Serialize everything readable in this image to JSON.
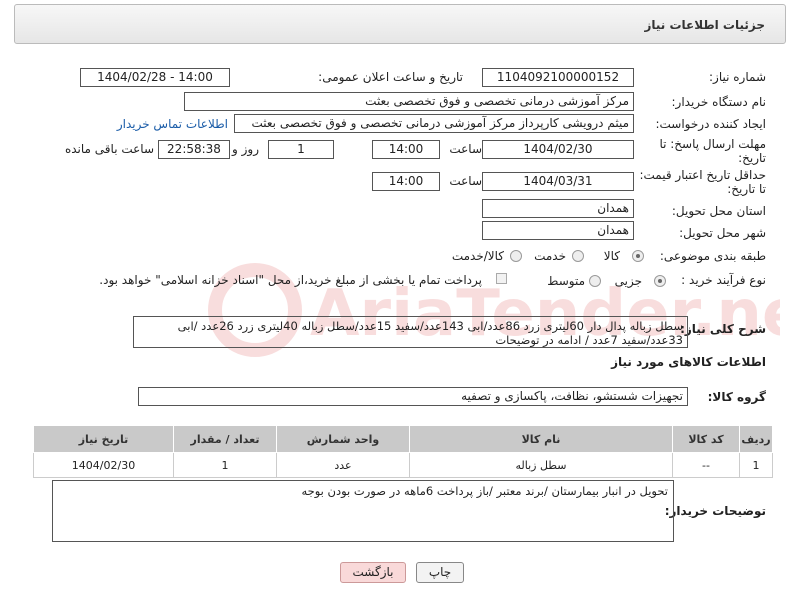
{
  "header": {
    "title": "جزئیات اطلاعات نیاز"
  },
  "form": {
    "need_number_label": "شماره نیاز:",
    "need_number": "1104092100000152",
    "announce_label": "تاریخ و ساعت اعلان عمومی:",
    "announce_value": "1404/02/28 - 14:00",
    "buyer_org_label": "نام دستگاه خریدار:",
    "buyer_org": "مرکز آموزشی درمانی تخصصی و فوق تخصصی بعثت",
    "creator_label": "ایجاد کننده درخواست:",
    "creator": "میثم درویشی کارپرداز مرکز آموزشی درمانی تخصصی و فوق تخصصی بعثت",
    "contact_link": "اطلاعات تماس خریدار",
    "reply_deadline_label_1": "مهلت ارسال پاسخ: تا",
    "reply_deadline_label_2": "تاریخ:",
    "reply_date": "1404/02/30",
    "time_label": "ساعت",
    "reply_time": "14:00",
    "days_value": "1",
    "days_label": "روز و",
    "remaining_time": "22:58:38",
    "remaining_label": "ساعت باقی مانده",
    "price_validity_label_1": "حداقل تاریخ اعتبار قیمت:",
    "price_validity_label_2": "تا تاریخ:",
    "price_date": "1404/03/31",
    "price_time": "14:00",
    "province_label": "استان محل تحویل:",
    "province": "همدان",
    "city_label": "شهر محل تحویل:",
    "city": "همدان",
    "category_label": "طبقه بندی موضوعی:",
    "category_options": [
      "کالا",
      "خدمت",
      "کالا/خدمت"
    ],
    "category_selected": "کالا",
    "process_label": "نوع فرآیند خرید :",
    "process_options": [
      "جزیی",
      "متوسط"
    ],
    "process_selected": "جزیی",
    "payment_note": "پرداخت تمام یا بخشی از مبلغ خرید،از محل \"اسناد خزانه اسلامی\" خواهد بود."
  },
  "description": {
    "label": "شرح کلی نیاز:",
    "line1": "سطل زباله پدال دار 60لیتری زرد  86عدد/ابی 143عدد/سفید  15عدد/سطل زباله 40لیتری زرد 26عدد /ابی",
    "line2": "33عدد/سفید  7عدد / ادامه در توضیحات"
  },
  "goods": {
    "section_title": "اطلاعات کالاهای مورد نیاز",
    "group_label": "گروه کالا:",
    "group_value": "تجهیزات شستشو، نظافت، پاکسازی و تصفیه",
    "columns": [
      "ردیف",
      "کد کالا",
      "نام کالا",
      "واحد شمارش",
      "تعداد / مقدار",
      "تاریخ نیاز"
    ],
    "rows": [
      {
        "row": "1",
        "code": "--",
        "name": "سطل زباله",
        "unit": "عدد",
        "qty": "1",
        "date": "1404/02/30"
      }
    ]
  },
  "buyer_notes": {
    "label": "توضیحات خریدار:",
    "text": "تحویل در انبار بیمارستان /برند معتبر /باز پرداخت 6ماهه در صورت بودن بوجه"
  },
  "buttons": {
    "print": "چاپ",
    "back": "بازگشت"
  },
  "watermark": {
    "text": "AriaTender.net"
  },
  "colors": {
    "link": "#1a5ca8",
    "back_button": "#f9d9d9",
    "table_header": "#c9c9c9"
  }
}
